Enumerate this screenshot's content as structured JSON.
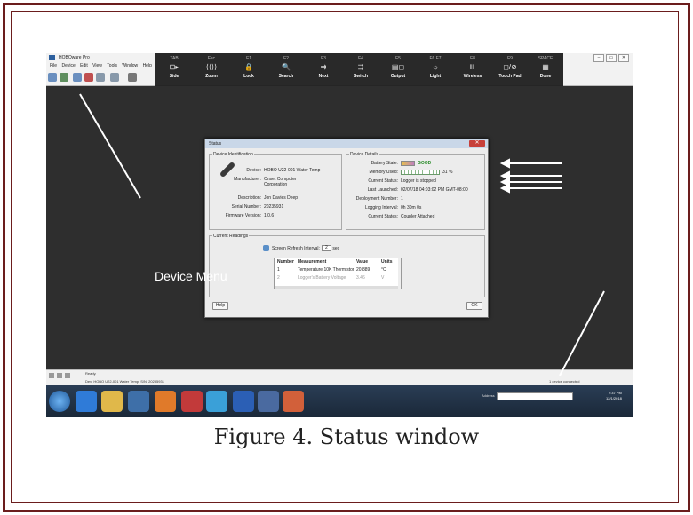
{
  "window": {
    "title": "HOBOware Pro",
    "controls": [
      "–",
      "▭",
      "✕"
    ]
  },
  "menu": [
    "File",
    "Device",
    "Edit",
    "View",
    "Tools",
    "Window",
    "Help"
  ],
  "key_overlay": [
    {
      "key": "TAB",
      "glyph": "⊟▸",
      "label": "Side"
    },
    {
      "key": "Esc",
      "glyph": "⟨⟨⟩⟩",
      "label": "Zoom"
    },
    {
      "key": "F1",
      "glyph": "🔒",
      "label": "Lock"
    },
    {
      "key": "F2",
      "glyph": "🔍",
      "label": "Search"
    },
    {
      "key": "F3",
      "glyph": "⇉",
      "label": "Next"
    },
    {
      "key": "F4",
      "glyph": "⇶",
      "label": "Switch"
    },
    {
      "key": "F5",
      "glyph": "▤◻",
      "label": "Output"
    },
    {
      "key": "F6 F7",
      "glyph": "☼",
      "label": "Light"
    },
    {
      "key": "F8",
      "glyph": "⊪",
      "label": "Wireless"
    },
    {
      "key": "F9",
      "glyph": "◻/⊘",
      "label": "Touch Pad"
    },
    {
      "key": "SPACE",
      "glyph": "▦",
      "label": "Done"
    }
  ],
  "dialog": {
    "title": "Status",
    "close": "✕",
    "identification": {
      "title": "Device Identification",
      "fields": [
        {
          "label": "Device:",
          "value": "HOBO U22-001 Water Temp"
        },
        {
          "label": "Manufacturer:",
          "value": "Onset Computer Corporation"
        },
        {
          "label": "Description:",
          "value": "Jon Davies Deep"
        },
        {
          "label": "Serial Number:",
          "value": "20235931"
        },
        {
          "label": "Firmware Version:",
          "value": "1.0.6"
        }
      ]
    },
    "details": {
      "title": "Device Details",
      "battery_label": "Battery State:",
      "battery_value": "GOOD",
      "memory_label": "Memory Used:",
      "memory_value": "31 %",
      "memory_fraction": 0.31,
      "fields": [
        {
          "label": "Current Status:",
          "value": "Logger is stopped"
        },
        {
          "label": "Last Launched:",
          "value": "02/07/18 04:03:02 PM GMT-08:00"
        },
        {
          "label": "Deployment Number:",
          "value": "1"
        },
        {
          "label": "Logging Interval:",
          "value": "0h 30m 0s"
        },
        {
          "label": "Current States:",
          "value": "Coupler Attached"
        }
      ]
    },
    "readings": {
      "title": "Current Readings",
      "refresh_label": "Screen Refresh Interval:",
      "refresh_value": "2",
      "refresh_unit": "sec",
      "columns": [
        "Number",
        "Measurement",
        "Value",
        "Units"
      ],
      "rows": [
        [
          "1",
          "Temperature 10K Thermistor",
          "20.889",
          "°C"
        ],
        [
          "2",
          "Logger's Battery Voltage",
          "3.46",
          "V"
        ]
      ]
    },
    "help_button": "Help",
    "ok_button": "OK"
  },
  "statusbar": {
    "ready": "Ready.",
    "device_line": "Dev: HOBO U22-001 Water Temp, S/N: 20235931",
    "devices_connected": "1 device connected"
  },
  "taskbar": {
    "address_label": "Address",
    "time": "2:37 PM",
    "date": "12/1/2018"
  },
  "annotation": {
    "label": "Device Menu"
  },
  "caption": "Figure 4. Status window",
  "colors": {
    "frame": "#6b1d1d",
    "workspace": "#2e2e2e",
    "battery_good": "#2a8c2a"
  }
}
